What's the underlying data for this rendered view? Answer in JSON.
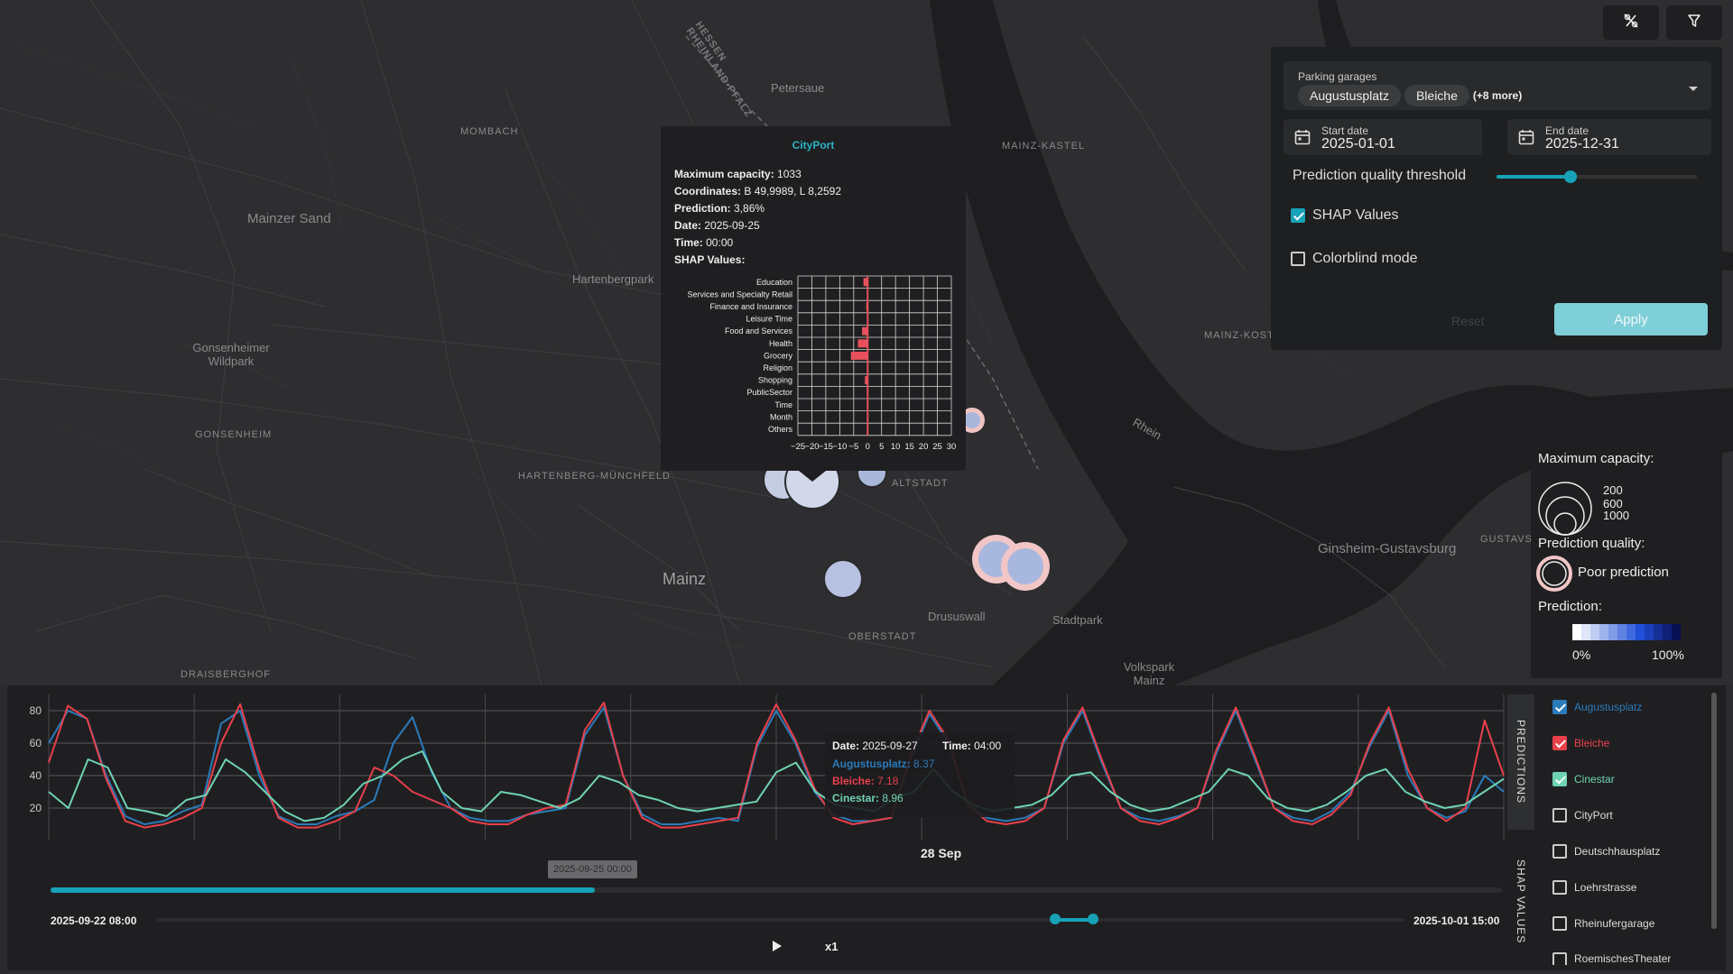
{
  "toolbar": {
    "icon1": "percent-off-icon",
    "icon2": "filter-icon"
  },
  "filter_panel": {
    "garages_label": "Parking garages",
    "chips": [
      "Augustusplatz",
      "Bleiche"
    ],
    "more": "(+8 more)",
    "start_label": "Start date",
    "start_value": "2025-01-01",
    "end_label": "End date",
    "end_value": "2025-12-31",
    "threshold_label": "Prediction quality threshold",
    "threshold_value": 0.37,
    "shap_label": "SHAP Values",
    "shap_checked": true,
    "colorblind_label": "Colorblind mode",
    "colorblind_checked": false,
    "reset_label": "Reset",
    "apply_label": "Apply"
  },
  "map": {
    "labels": [
      "Mainzer Sand",
      "Hartenbergpark",
      "Gonsenheimer Wildpark",
      "Gonsenheim",
      "Mombach",
      "Hartenberg-Münchfeld",
      "Mainz",
      "Altstadt",
      "Oberstadt",
      "Drususwall",
      "Stadtpark",
      "Volkspark Mainz",
      "Ginsheim-Gustavsburg",
      "Mainz-Kastel",
      "Mainz-Kostheim",
      "Petersaue",
      "Draisberghof",
      "Hessen Rheinland-Pfalz",
      "Rhein",
      "Gustavsb"
    ]
  },
  "popup": {
    "title": "CityPort",
    "rows": [
      {
        "label": "Maximum capacity:",
        "value": " 1033"
      },
      {
        "label": "Coordinates:",
        "value": " B 49,9989, L 8,2592"
      },
      {
        "label": "Prediction:",
        "value": " 3,86%"
      },
      {
        "label": "Date:",
        "value": " 2025-09-25"
      },
      {
        "label": "Time:",
        "value": " 00:00"
      },
      {
        "label": "SHAP Values:",
        "value": ""
      }
    ],
    "shap_chart": {
      "type": "bar",
      "categories": [
        "Education",
        "Services and Specialty Retail",
        "Finance and Insurance",
        "Leisure Time",
        "Food and Services",
        "Health",
        "Grocery",
        "Religion",
        "Shopping",
        "PublicSector",
        "Time",
        "Month",
        "Others"
      ],
      "values": [
        -1.5,
        0,
        -0.5,
        0,
        -2,
        -3.5,
        -6,
        0,
        -1,
        0,
        0,
        0,
        0
      ],
      "xticks": [
        "−25",
        "−20",
        "−15",
        "−10",
        "−5",
        "0",
        "5",
        "10",
        "15",
        "20",
        "25",
        "30"
      ],
      "xlim": [
        -25,
        30
      ],
      "color": "#e8505b"
    }
  },
  "legend": {
    "capacity_title": "Maximum capacity:",
    "capacity_values": [
      "200",
      "600",
      "1000"
    ],
    "quality_title": "Prediction quality:",
    "poor_label": "Poor prediction",
    "prediction_title": "Prediction:",
    "pred_min": "0%",
    "pred_max": "100%",
    "gradient": [
      "#ffffff",
      "#dfe6f7",
      "#bfcdf2",
      "#9fb4ed",
      "#7f9be8",
      "#5f82e3",
      "#3f69de",
      "#2050d9",
      "#1a3fb8",
      "#142f96",
      "#0e1f75",
      "#081054"
    ]
  },
  "chart_data": {
    "type": "line",
    "yticks": [
      "80",
      "60",
      "40",
      "20"
    ],
    "ylim": [
      0,
      90
    ],
    "x_tick_label": "28 Sep",
    "series": [
      {
        "name": "Augustusplatz",
        "color": "#2b7bba",
        "values": [
          60,
          80,
          75,
          40,
          15,
          10,
          12,
          18,
          22,
          72,
          80,
          40,
          15,
          10,
          10,
          15,
          18,
          25,
          60,
          76,
          42,
          20,
          14,
          12,
          12,
          16,
          18,
          20,
          65,
          82,
          40,
          16,
          10,
          10,
          12,
          14,
          12,
          58,
          80,
          60,
          30,
          16,
          12,
          12,
          14,
          50,
          78,
          60,
          22,
          14,
          12,
          14,
          20,
          60,
          80,
          48,
          20,
          14,
          12,
          15,
          20,
          54,
          80,
          50,
          20,
          14,
          12,
          18,
          30,
          58,
          80,
          40,
          20,
          14,
          18,
          40,
          30
        ]
      },
      {
        "name": "Bleiche",
        "color": "#e8404b",
        "values": [
          48,
          83,
          75,
          38,
          12,
          8,
          10,
          14,
          20,
          60,
          84,
          44,
          14,
          8,
          8,
          12,
          18,
          45,
          40,
          30,
          25,
          20,
          12,
          10,
          10,
          16,
          20,
          22,
          68,
          85,
          40,
          14,
          8,
          8,
          10,
          12,
          14,
          60,
          84,
          62,
          32,
          14,
          10,
          12,
          14,
          52,
          80,
          62,
          22,
          12,
          10,
          12,
          20,
          62,
          82,
          50,
          20,
          12,
          10,
          14,
          20,
          56,
          82,
          52,
          20,
          12,
          10,
          16,
          28,
          60,
          82,
          44,
          20,
          12,
          20,
          74,
          40
        ]
      },
      {
        "name": "Cinestar",
        "color": "#6fd3b3",
        "values": [
          30,
          20,
          50,
          45,
          20,
          18,
          15,
          25,
          28,
          50,
          42,
          30,
          18,
          12,
          14,
          22,
          35,
          40,
          50,
          55,
          30,
          20,
          18,
          30,
          28,
          24,
          20,
          26,
          40,
          36,
          28,
          25,
          20,
          18,
          20,
          22,
          24,
          42,
          48,
          30,
          22,
          20,
          18,
          26,
          30,
          44,
          30,
          22,
          18,
          20,
          22,
          28,
          40,
          42,
          30,
          22,
          18,
          20,
          25,
          30,
          44,
          40,
          26,
          20,
          18,
          22,
          30,
          40,
          44,
          30,
          24,
          20,
          22,
          30,
          38
        ]
      }
    ]
  },
  "chart_tooltip": {
    "date_label": "Date:",
    "date_value": " 2025-09-27",
    "time_label": "Time:",
    "time_value": " 04:00",
    "rows": [
      {
        "label": "Augustusplatz:",
        "value": " 8.37",
        "color": "#2b7bba"
      },
      {
        "label": "Bleiche:",
        "value": " 7.18",
        "color": "#e8404b"
      },
      {
        "label": "Cinestar:",
        "value": " 8.96",
        "color": "#6fd3b3"
      }
    ]
  },
  "timeline": {
    "cursor_label": "2025-09-25 00:00",
    "progress": 0.375,
    "start_label": "2025-09-22 08:00",
    "end_label": "2025-10-01 15:00",
    "speed_label": "x1",
    "range_low": 0.72,
    "range_high": 0.75
  },
  "side_tabs": {
    "predictions": "PREDICTIONS",
    "shap": "SHAP VALUES"
  },
  "garage_list": [
    {
      "label": "Augustusplatz",
      "checked": true,
      "color": "#2b7bba"
    },
    {
      "label": "Bleiche",
      "checked": true,
      "color": "#e8404b"
    },
    {
      "label": "Cinestar",
      "checked": true,
      "color": "#6fd3b3"
    },
    {
      "label": "CityPort",
      "checked": false,
      "color": "#dddddd"
    },
    {
      "label": "Deutschhausplatz",
      "checked": false,
      "color": "#dddddd"
    },
    {
      "label": "Loehrstrasse",
      "checked": false,
      "color": "#dddddd"
    },
    {
      "label": "Rheinufergarage",
      "checked": false,
      "color": "#dddddd"
    },
    {
      "label": "RoemischesTheater",
      "checked": false,
      "color": "#dddddd"
    }
  ]
}
